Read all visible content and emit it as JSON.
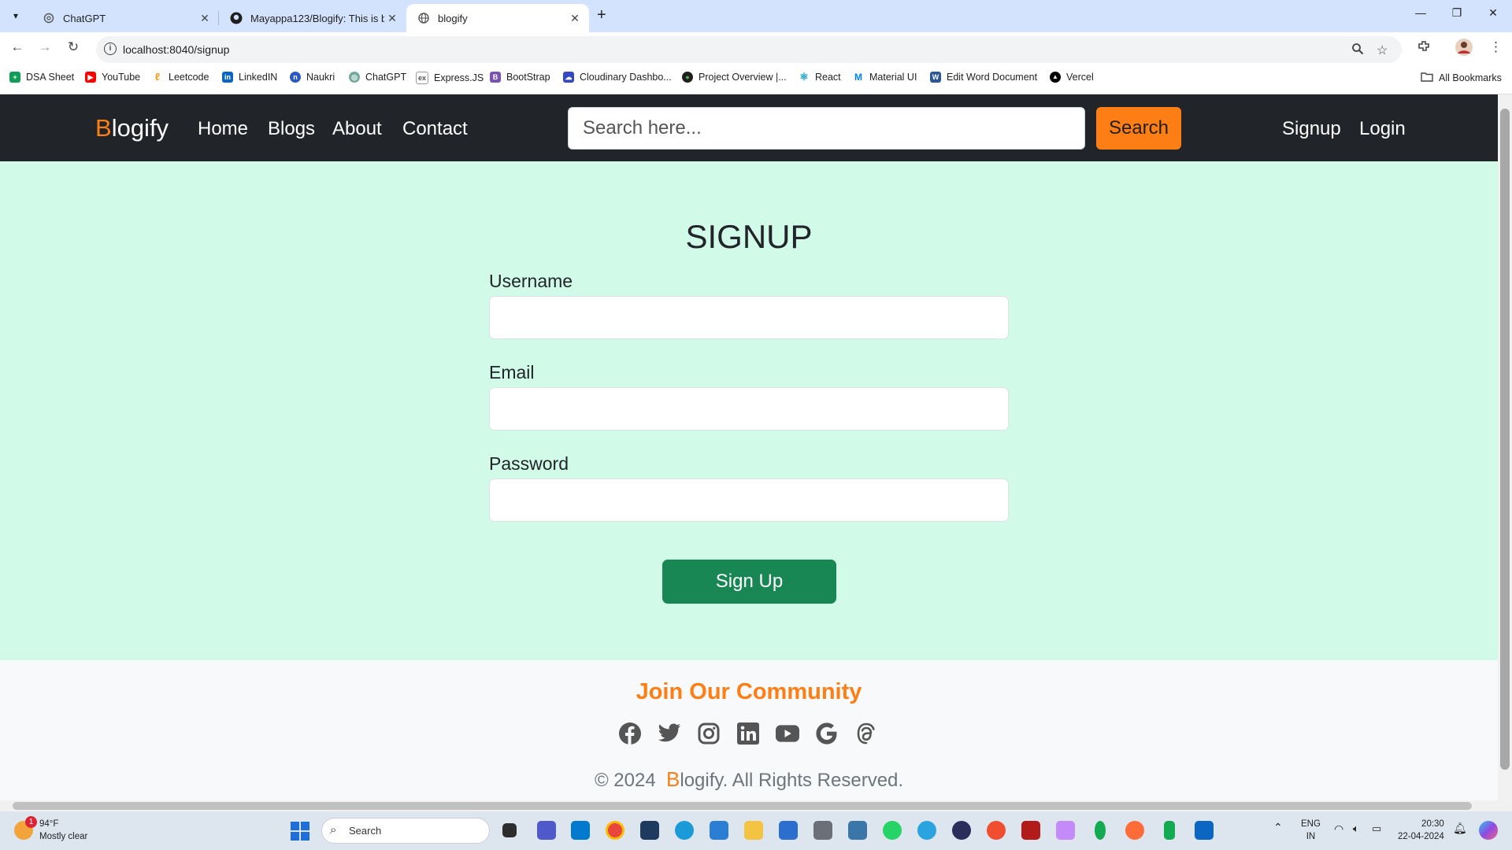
{
  "browser": {
    "tabs": [
      {
        "title": "ChatGPT",
        "active": false
      },
      {
        "title": "Mayappa123/Blogify: This is bl",
        "active": false
      },
      {
        "title": "blogify",
        "active": true
      }
    ],
    "url": "localhost:8040/signup",
    "bookmarks": [
      "DSA Sheet",
      "YouTube",
      "Leetcode",
      "LinkedIN",
      "Naukri",
      "ChatGPT",
      "Express.JS",
      "BootStrap",
      "Cloudinary Dashbo...",
      "Project Overview |...",
      "React",
      "Material UI",
      "Edit Word Document",
      "Vercel"
    ],
    "all_bookmarks": "All Bookmarks"
  },
  "navbar": {
    "brand_first": "B",
    "brand_rest": "logify",
    "links": [
      "Home",
      "Blogs",
      "About",
      "Contact"
    ],
    "search_placeholder": "Search here...",
    "search_button": "Search",
    "signup": "Signup",
    "login": "Login"
  },
  "form": {
    "title": "SIGNUP",
    "username_label": "Username",
    "email_label": "Email",
    "password_label": "Password",
    "submit": "Sign Up"
  },
  "footer": {
    "heading": "Join Our Community",
    "socials": [
      "facebook-icon",
      "twitter-icon",
      "instagram-icon",
      "linkedin-icon",
      "youtube-icon",
      "google-icon",
      "threads-icon"
    ],
    "copyright_prefix": "© 2024",
    "copyright_brand_first": "B",
    "copyright_suffix": "logify. All Rights Reserved."
  },
  "taskbar": {
    "weather_badge": "1",
    "temperature": "94°F",
    "condition": "Mostly clear",
    "search": "Search",
    "lang_top": "ENG",
    "lang_bottom": "IN",
    "time": "20:30",
    "date": "22-04-2024"
  },
  "colors": {
    "navbar_bg": "#212529",
    "accent_orange": "#fd7e14",
    "page_bg": "#d1fae9",
    "signup_green": "#198754",
    "footer_bg": "#f8f9fa"
  }
}
